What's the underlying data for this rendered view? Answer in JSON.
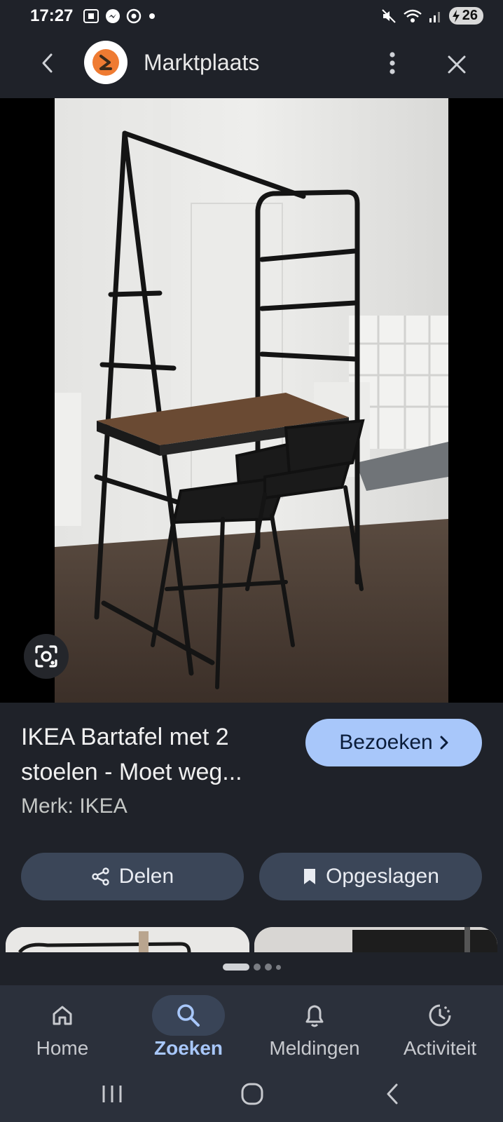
{
  "status_bar": {
    "time": "17:27",
    "battery": "26",
    "left_icons": [
      "screenshot-icon",
      "messenger-icon",
      "chrome-icon",
      "dot-icon"
    ],
    "right_icons": [
      "mute-icon",
      "wifi-icon",
      "signal-icon",
      "battery-charging-icon"
    ]
  },
  "app_bar": {
    "site_name": "Marktplaats",
    "back_icon": "chevron-left-icon",
    "more_icon": "more-vert-icon",
    "close_icon": "close-icon"
  },
  "result": {
    "title": "IKEA Bartafel met 2 stoelen - Moet weg...",
    "brand": "Merk: IKEA",
    "visit_label": "Bezoeken",
    "share_label": "Delen",
    "saved_label": "Opgeslagen"
  },
  "carousel": {
    "pages": 4,
    "active_index": 0
  },
  "bottom_nav": {
    "items": [
      {
        "label": "Home",
        "icon": "home-icon",
        "active": false
      },
      {
        "label": "Zoeken",
        "icon": "search-icon",
        "active": true
      },
      {
        "label": "Meldingen",
        "icon": "bell-icon",
        "active": false
      },
      {
        "label": "Activiteit",
        "icon": "activity-icon",
        "active": false
      }
    ]
  },
  "colors": {
    "background": "#1f2229",
    "accent": "#a8c7fa",
    "button": "#3b4658",
    "nav": "#2b303b",
    "brand_orange": "#ef7b32"
  }
}
